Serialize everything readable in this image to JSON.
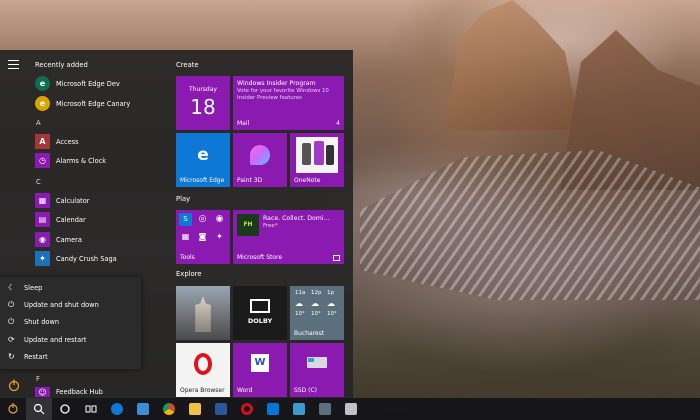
{
  "start_menu": {
    "recently_added_title": "Recently added",
    "recent": [
      {
        "label": "Microsoft Edge Dev",
        "icon": "edge-dev-icon",
        "color": "#0f6e54"
      },
      {
        "label": "Microsoft Edge Canary",
        "icon": "edge-canary-icon",
        "color": "#d8a400"
      }
    ],
    "letters": [
      "A",
      "C",
      "F"
    ],
    "apps_a": [
      {
        "label": "Access",
        "icon": "access-icon",
        "color": "#a4373a"
      },
      {
        "label": "Alarms & Clock",
        "icon": "alarm-clock-icon",
        "color": "#8a1ab0"
      }
    ],
    "apps_c": [
      {
        "label": "Calculator",
        "icon": "calculator-icon",
        "color": "#8a1ab0"
      },
      {
        "label": "Calendar",
        "icon": "calendar-icon",
        "color": "#8a1ab0"
      },
      {
        "label": "Camera",
        "icon": "camera-icon",
        "color": "#8a1ab0"
      },
      {
        "label": "Candy Crush Saga",
        "icon": "candy-crush-icon",
        "color": "#1f70b8"
      }
    ],
    "apps_f": [
      {
        "label": "Feedback Hub",
        "icon": "feedback-hub-icon",
        "color": "#8a1ab0"
      }
    ],
    "power_menu": [
      {
        "label": "Sleep",
        "icon": "moon-icon"
      },
      {
        "label": "Update and shut down",
        "icon": "update-power-icon"
      },
      {
        "label": "Shut down",
        "icon": "power-icon"
      },
      {
        "label": "Update and restart",
        "icon": "update-restart-icon"
      },
      {
        "label": "Restart",
        "icon": "restart-icon"
      }
    ]
  },
  "tiles": {
    "create_title": "Create",
    "play_title": "Play",
    "explore_title": "Explore",
    "calendar": {
      "day": "Thursday",
      "date": "18"
    },
    "mail": {
      "header": "Windows Insider Program",
      "body": "Vote for your favorite Windows 10 Insider Preview features",
      "label": "Mail",
      "count": "4"
    },
    "edge": {
      "label": "Microsoft Edge"
    },
    "paint3d": {
      "label": "Paint 3D"
    },
    "onenote": {
      "label": "OneNote"
    },
    "tools": {
      "label": "Tools"
    },
    "store": {
      "title": "Race. Collect. Domi...",
      "sub": "Free*",
      "label": "Microsoft Store",
      "badge": "FH"
    },
    "photos": {
      "label": ""
    },
    "dolby": {
      "text": "DOLBY"
    },
    "weather": {
      "times": [
        "11a",
        "12p",
        "1p"
      ],
      "temps": [
        "10°",
        "10°",
        "10°"
      ],
      "label": "Bucharest"
    },
    "opera": {
      "label": "Opera Browser"
    },
    "word": {
      "label": "Word",
      "icon_text": "W"
    },
    "ssd": {
      "label": "SSD (C)"
    }
  },
  "colors": {
    "tile_purple": "#8a1ab0",
    "tile_blue": "#0d78d6",
    "menu_bg": "#262626"
  },
  "taskbar": {
    "items": [
      "search-icon",
      "cortana-icon",
      "task-view-icon",
      "edge-icon",
      "store-icon",
      "chrome-icon",
      "file-explorer-icon",
      "word-icon",
      "opera-icon",
      "onenote-icon",
      "settings-icon",
      "photos-icon",
      "snip-icon"
    ],
    "colors": [
      "",
      "",
      "",
      "#0d78d6",
      "#3b8fd9",
      "#e8b100",
      "#f0c040",
      "#2b579a",
      "#d0121d",
      "#0078d7",
      "#3d9ad0",
      "#5b6f7d",
      "#c0c0c8"
    ]
  }
}
